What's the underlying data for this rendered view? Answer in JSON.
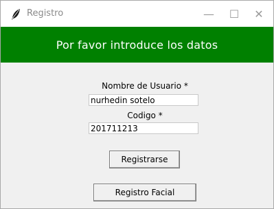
{
  "window": {
    "title": "Registro",
    "icon": "feather-icon",
    "controls": {
      "minimize_glyph": "—",
      "maximize_glyph": "☐",
      "close_glyph": "✕"
    }
  },
  "banner": {
    "text": "Por favor introduce los datos",
    "background": "#008000",
    "color": "#ffffff"
  },
  "form": {
    "username_label": "Nombre de Usuario *",
    "username_value": "nurhedin sotelo",
    "code_label": "Codigo *",
    "code_value": "201711213"
  },
  "buttons": {
    "register_label": "Registrarse",
    "facial_label": "Registro Facial"
  }
}
